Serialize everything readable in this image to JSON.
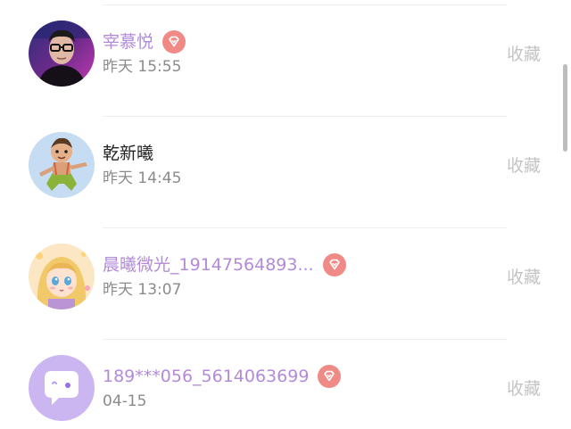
{
  "items": [
    {
      "name": "宰慕悦",
      "time": "昨天 15:55",
      "vip": true,
      "action": "收藏",
      "avatar": "avatar-man-glasses"
    },
    {
      "name": "乾新曦",
      "time": "昨天 14:45",
      "vip": false,
      "action": "收藏",
      "avatar": "avatar-cartoon-boy"
    },
    {
      "name": "晨曦微光_19147564893...",
      "time": "昨天 13:07",
      "vip": true,
      "action": "收藏",
      "avatar": "avatar-anime-girl"
    },
    {
      "name": "189***056_5614063699",
      "time": "04-15",
      "vip": true,
      "action": "收藏",
      "avatar": "avatar-default-chat-bubble"
    }
  ],
  "colors": {
    "vip_name": "#b38ad9",
    "plain_name": "#222222",
    "time": "#8b8b8b",
    "action": "#c4c4c4",
    "vip_badge": "#f08a87"
  }
}
